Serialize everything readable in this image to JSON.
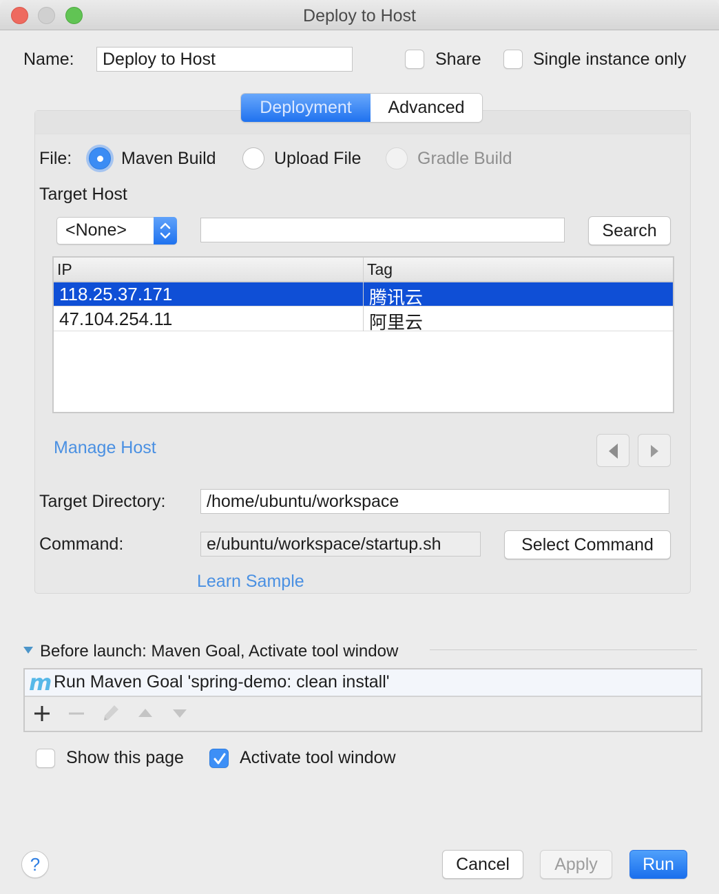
{
  "window": {
    "title": "Deploy to Host"
  },
  "config": {
    "name_label": "Name:",
    "name_value": "Deploy to Host",
    "share_label": "Share",
    "share_checked": false,
    "single_instance_label": "Single instance only",
    "single_instance_checked": false
  },
  "tabs": [
    {
      "label": "Deployment",
      "active": true
    },
    {
      "label": "Advanced",
      "active": false
    }
  ],
  "deployment": {
    "file_label": "File:",
    "file_options": [
      {
        "label": "Maven Build",
        "selected": true,
        "enabled": true
      },
      {
        "label": "Upload File",
        "selected": false,
        "enabled": true
      },
      {
        "label": "Gradle Build",
        "selected": false,
        "enabled": false
      }
    ],
    "target_host_label": "Target Host",
    "host_dropdown_value": "<None>",
    "search_value": "",
    "search_button": "Search",
    "table": {
      "columns": [
        "IP",
        "Tag"
      ],
      "rows": [
        {
          "ip": "118.25.37.171",
          "tag": "腾讯云",
          "selected": true
        },
        {
          "ip": "47.104.254.11",
          "tag": "阿里云",
          "selected": false
        }
      ]
    },
    "manage_host_link": "Manage Host",
    "target_directory_label": "Target Directory:",
    "target_directory_value": "/home/ubuntu/workspace",
    "command_label": "Command:",
    "command_value": "e/ubuntu/workspace/startup.sh",
    "select_command_button": "Select Command",
    "learn_sample_link": "Learn Sample"
  },
  "before_launch": {
    "header": "Before launch: Maven Goal, Activate tool window",
    "expanded": true,
    "items": [
      {
        "icon": "maven-icon",
        "label": "Run Maven Goal 'spring-demo: clean install'"
      }
    ],
    "toolbar": {
      "add": "+",
      "remove": "−",
      "edit": "edit",
      "move_up": "▲",
      "move_down": "▼"
    }
  },
  "options": {
    "show_this_page_label": "Show this page",
    "show_this_page_checked": false,
    "activate_tool_window_label": "Activate tool window",
    "activate_tool_window_checked": true
  },
  "footer": {
    "help": "?",
    "cancel": "Cancel",
    "apply": "Apply",
    "run": "Run"
  },
  "colors": {
    "accent": "#1f72ef",
    "selection": "#0f4fd6",
    "link": "#4a90e2"
  }
}
